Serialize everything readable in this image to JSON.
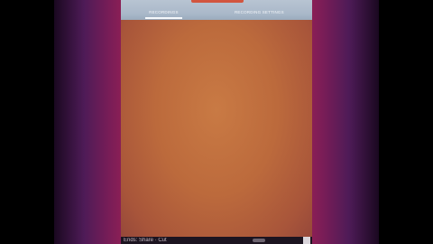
{
  "tabs": [
    {
      "label": "RECORDINGS",
      "active": true
    },
    {
      "label": "RECORDING SETTINGS",
      "active": false
    }
  ],
  "colors": {
    "screen_background": "#c97a44",
    "tab_bar": "#a9b8c9",
    "top_accent": "#d2553f",
    "side_glow": "#7b1d57"
  },
  "bottom_bar": {
    "text": "Ends: Share · Cut"
  }
}
